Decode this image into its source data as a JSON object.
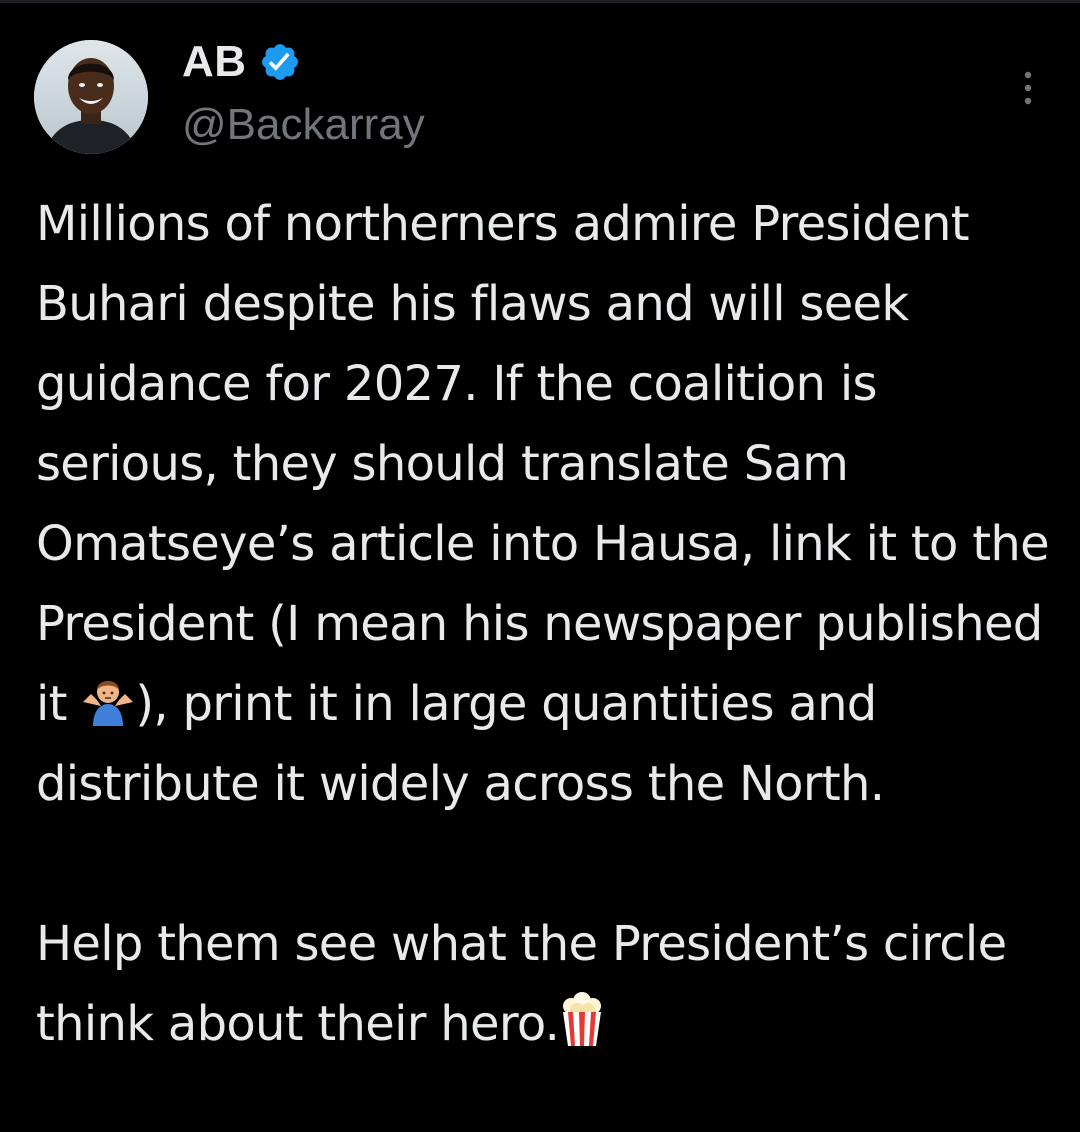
{
  "tweet": {
    "author": {
      "display_name": "AB",
      "handle": "@Backarray",
      "verified": true,
      "avatar_icon": "person-portrait-avatar",
      "verified_icon": "verified-badge-icon"
    },
    "more_icon": "vertical-ellipsis-icon",
    "body": {
      "paragraph_1_before_emoji": "Millions of northerners admire President Buhari despite his flaws and will seek guidance for 2027. If the coalition is serious, they should translate Sam Omatseye’s article into Hausa, link it to the President (I mean his newspaper published it ",
      "paragraph_1_emoji": "person-shrugging-emoji",
      "paragraph_1_after_emoji": "), print it in large quantities and distribute it widely across the North.",
      "paragraph_2_before_emoji": "Help them see what the President’s circle think about their hero.",
      "paragraph_2_emoji": "popcorn-emoji"
    }
  },
  "colors": {
    "background": "#000000",
    "text_primary": "#e7e9ea",
    "text_secondary": "#71767b",
    "verified_blue": "#1d9bf0"
  }
}
